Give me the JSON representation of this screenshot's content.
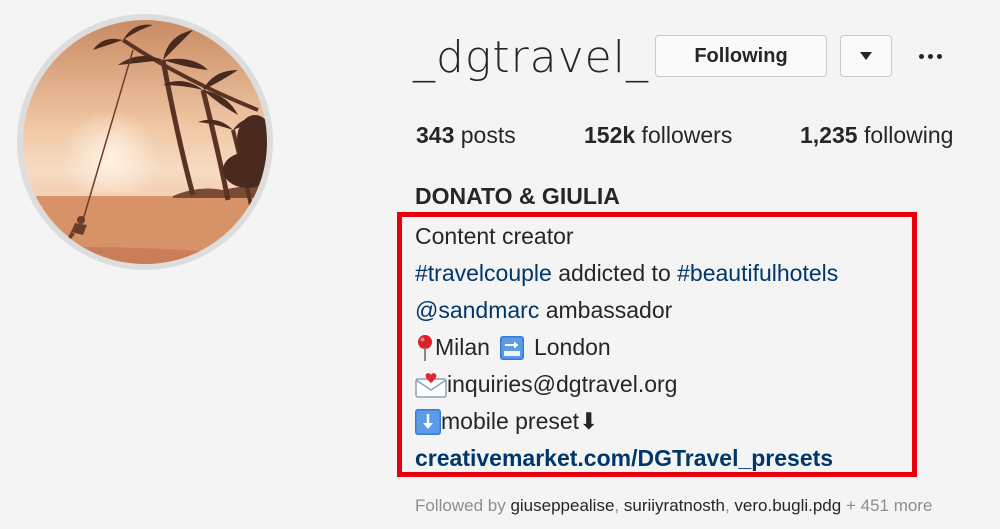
{
  "profile": {
    "username": "_dgtravel_",
    "following_button": "Following",
    "stats": {
      "posts_count": "343",
      "posts_label": " posts",
      "followers_count": "152k",
      "followers_label": " followers",
      "following_count": "1,235",
      "following_label": " following"
    },
    "full_name": "DONATO & GIULIA",
    "bio": {
      "line1": "Content creator",
      "hashtag1": "#travelcouple",
      "middle_text": " addicted to ",
      "hashtag2": "#beautifulhotels",
      "mention": "@sandmarc",
      "mention_suffix": " ambassador",
      "city_from": "Milan",
      "city_to": "London",
      "email": "inquiries@dgtravel.org",
      "preset_text": "mobile preset",
      "preset_arrow": "⬇",
      "website": "creativemarket.com/DGTravel_presets"
    },
    "followed_by": {
      "prefix": "Followed by ",
      "names": [
        "giuseppealise",
        "suriiyratnosth",
        "vero.bugli.pdg"
      ],
      "sep": ", ",
      "more": " + 451 more"
    }
  },
  "icons": {
    "avatar": "profile-photo",
    "dropdown": "caret-down-icon",
    "more": "more-options-icon",
    "pin": "round-pushpin-emoji",
    "soon": "soon-arrow-emoji",
    "envelope": "envelope-heart-emoji",
    "down": "down-arrow-button-emoji"
  },
  "colors": {
    "highlight_border": "#e8000c",
    "link": "#00376b",
    "muted": "#8e8e8e"
  }
}
